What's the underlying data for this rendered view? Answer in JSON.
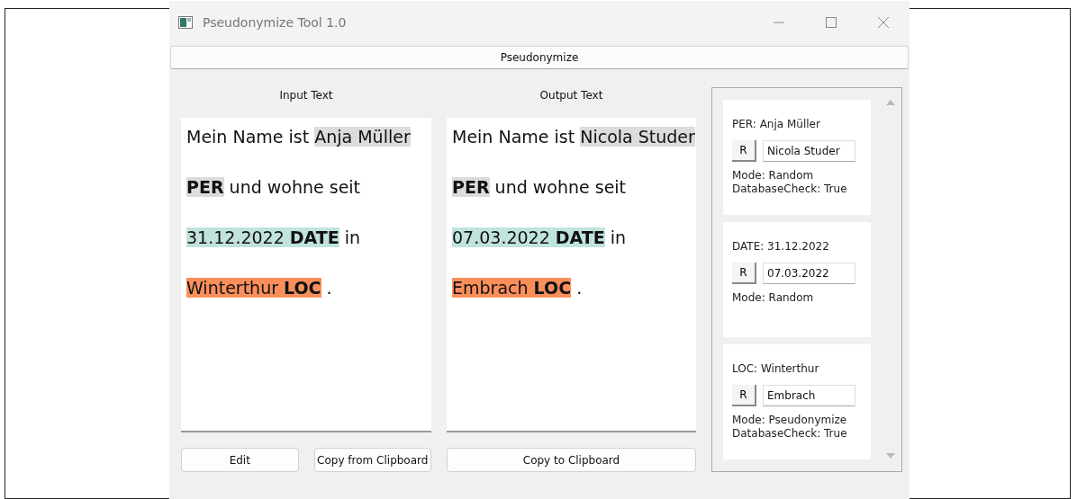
{
  "window": {
    "title": "Pseudonymize Tool 1.0"
  },
  "toolbar": {
    "button": "Pseudonymize"
  },
  "input": {
    "label": "Input Text",
    "lines": [
      [
        {
          "text": "Mein Name ist ",
          "bold": false
        },
        {
          "text": "Anja Müller",
          "bold": false,
          "color": "#dcdcdc"
        }
      ],
      [
        {
          "text": "PER",
          "bold": true,
          "color": "#dcdcdc"
        },
        {
          "text": " und wohne seit",
          "bold": false
        }
      ],
      [
        {
          "text": "31.12.2022 ",
          "bold": false,
          "color": "#c0e3dd"
        },
        {
          "text": "DATE",
          "bold": true,
          "color": "#c0e3dd"
        },
        {
          "text": " in",
          "bold": false
        }
      ],
      [
        {
          "text": "Winterthur ",
          "bold": false,
          "color": "#fb8f5c"
        },
        {
          "text": "LOC",
          "bold": true,
          "color": "#fb8f5c"
        },
        {
          "text": " .",
          "bold": false
        }
      ]
    ],
    "buttons": [
      "Edit",
      "Copy from Clipboard"
    ]
  },
  "output": {
    "label": "Output Text",
    "lines": [
      [
        {
          "text": "Mein Name ist ",
          "bold": false
        },
        {
          "text": "Nicola Studer",
          "bold": false,
          "color": "#dcdcdc"
        }
      ],
      [
        {
          "text": "PER",
          "bold": true,
          "color": "#dcdcdc"
        },
        {
          "text": " und wohne seit",
          "bold": false
        }
      ],
      [
        {
          "text": "07.03.2022 ",
          "bold": false,
          "color": "#c0e3dd"
        },
        {
          "text": "DATE",
          "bold": true,
          "color": "#c0e3dd"
        },
        {
          "text": " in",
          "bold": false
        }
      ],
      [
        {
          "text": "Embrach ",
          "bold": false,
          "color": "#fb8f5c"
        },
        {
          "text": "LOC",
          "bold": true,
          "color": "#fb8f5c"
        },
        {
          "text": " .",
          "bold": false
        }
      ]
    ],
    "buttons": [
      "Copy to Clipboard"
    ]
  },
  "entities": [
    {
      "title": "PER: Anja Müller",
      "button": "R",
      "value": "Nicola Studer",
      "details": [
        "Mode: Random",
        "DatabaseCheck: True"
      ]
    },
    {
      "title": "DATE: 31.12.2022",
      "button": "R",
      "value": "07.03.2022",
      "details": [
        "Mode: Random"
      ]
    },
    {
      "title": "LOC: Winterthur",
      "button": "R",
      "value": "Embrach",
      "details": [
        "Mode: Pseudonymize",
        "DatabaseCheck: True"
      ]
    }
  ]
}
